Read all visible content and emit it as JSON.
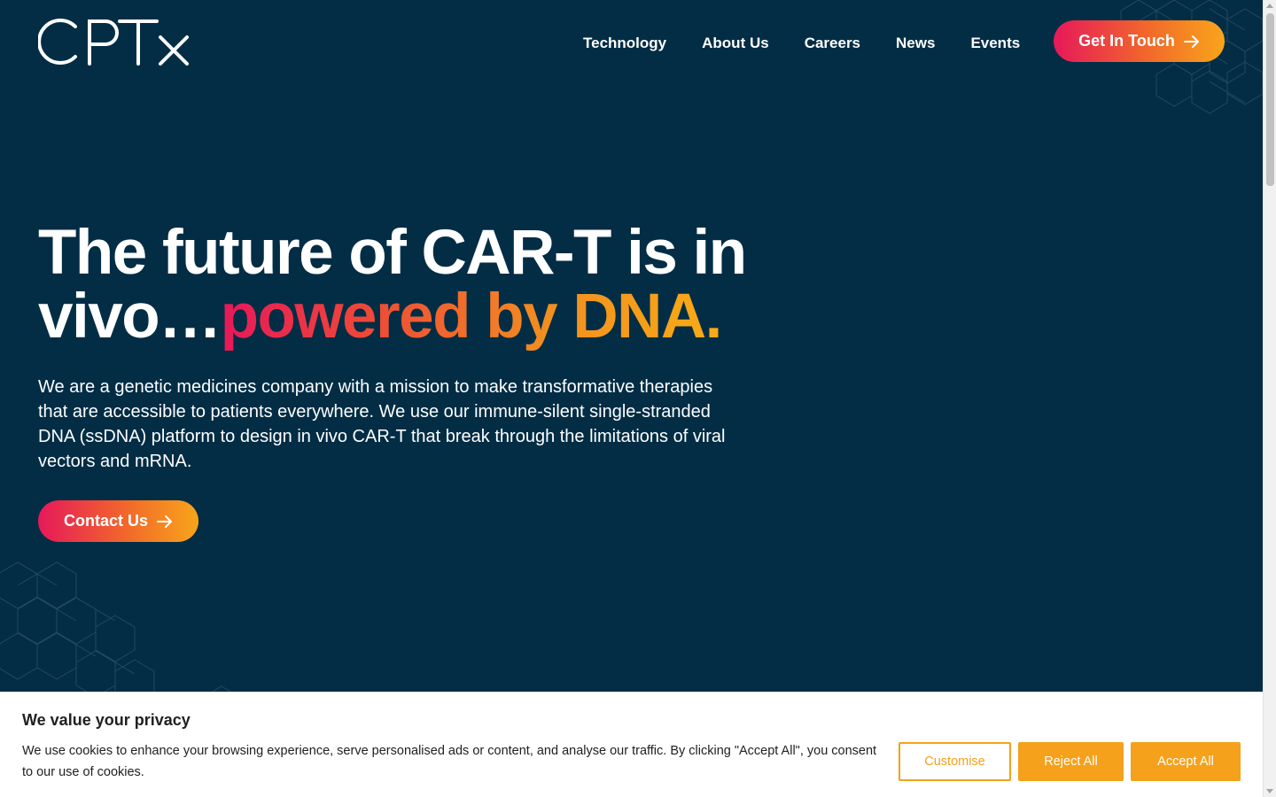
{
  "header": {
    "logo_text": "CPTx",
    "nav": [
      {
        "label": "Technology"
      },
      {
        "label": "About Us"
      },
      {
        "label": "Careers"
      },
      {
        "label": "News"
      },
      {
        "label": "Events"
      }
    ],
    "cta_label": "Get In Touch"
  },
  "hero": {
    "title_line1": "The future of CAR-T is in",
    "title_line2_plain": "vivo…",
    "title_line2_gradient": "powered by DNA.",
    "description": "We are a genetic medicines company with a mission to make transformative therapies that are accessible to patients everywhere. We use our immune-silent single-stranded DNA (ssDNA) platform to design in vivo CAR-T that break through the limitations of viral vectors and mRNA.",
    "cta_label": "Contact Us"
  },
  "cookie": {
    "title": "We value your privacy",
    "text": "We use cookies to enhance your browsing experience, serve personalised ads or content, and analyse our traffic. By clicking \"Accept All\", you consent to our use of cookies.",
    "customise_label": "Customise",
    "reject_label": "Reject All",
    "accept_label": "Accept All"
  },
  "colors": {
    "background": "#022d45",
    "accent_pink": "#e6185a",
    "accent_orange": "#f8a51a",
    "cookie_button": "#f5a11b"
  }
}
